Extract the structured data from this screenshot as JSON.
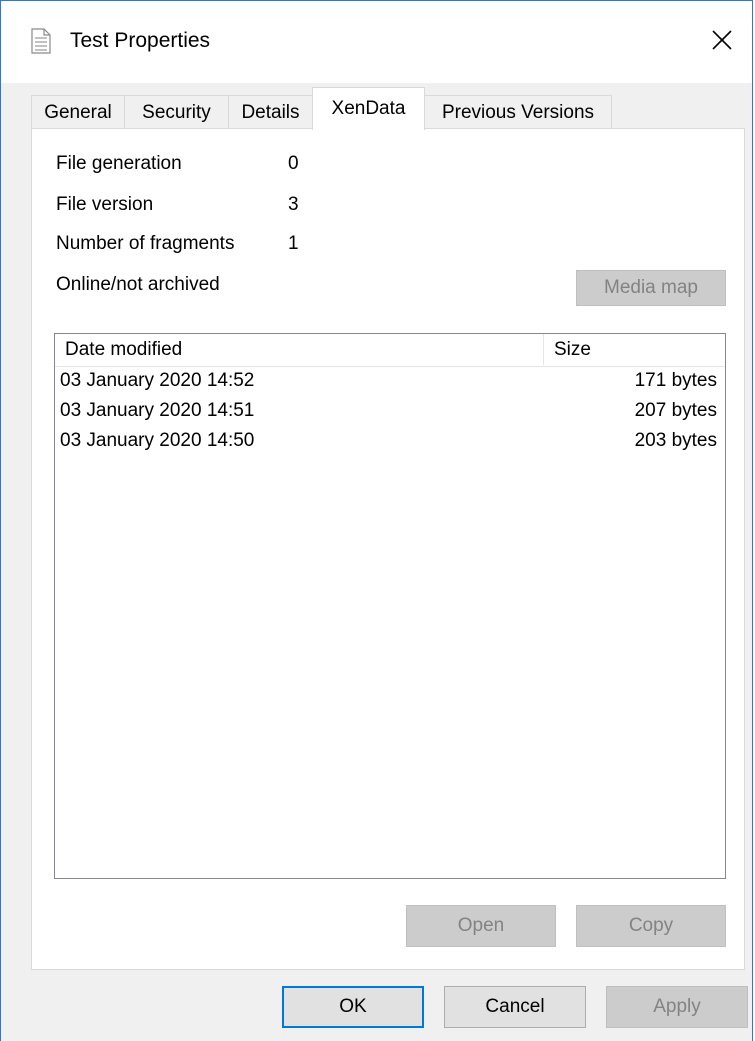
{
  "window": {
    "title": "Test Properties",
    "icon": "document-icon",
    "close_icon": "close-icon"
  },
  "tabs": [
    {
      "label": "General",
      "active": false
    },
    {
      "label": "Security",
      "active": false
    },
    {
      "label": "Details",
      "active": false
    },
    {
      "label": "XenData",
      "active": true
    },
    {
      "label": "Previous Versions",
      "active": false
    }
  ],
  "info": {
    "file_generation": {
      "label": "File generation",
      "value": "0"
    },
    "file_version": {
      "label": "File version",
      "value": "3"
    },
    "fragments": {
      "label": "Number of fragments",
      "value": "1"
    },
    "status": "Online/not archived"
  },
  "buttons": {
    "media_map": "Media map",
    "open": "Open",
    "copy": "Copy",
    "ok": "OK",
    "cancel": "Cancel",
    "apply": "Apply"
  },
  "list": {
    "columns": [
      "Date modified",
      "Size"
    ],
    "rows": [
      {
        "date": "03 January 2020 14:52",
        "size": "171 bytes"
      },
      {
        "date": "03 January 2020 14:51",
        "size": "207 bytes"
      },
      {
        "date": "03 January 2020 14:50",
        "size": "203 bytes"
      }
    ]
  },
  "colors": {
    "window_border": "#2b79d7",
    "dialog_bg": "#f0f0f0",
    "default_button_border": "#0078d7",
    "disabled_text": "#838383"
  }
}
